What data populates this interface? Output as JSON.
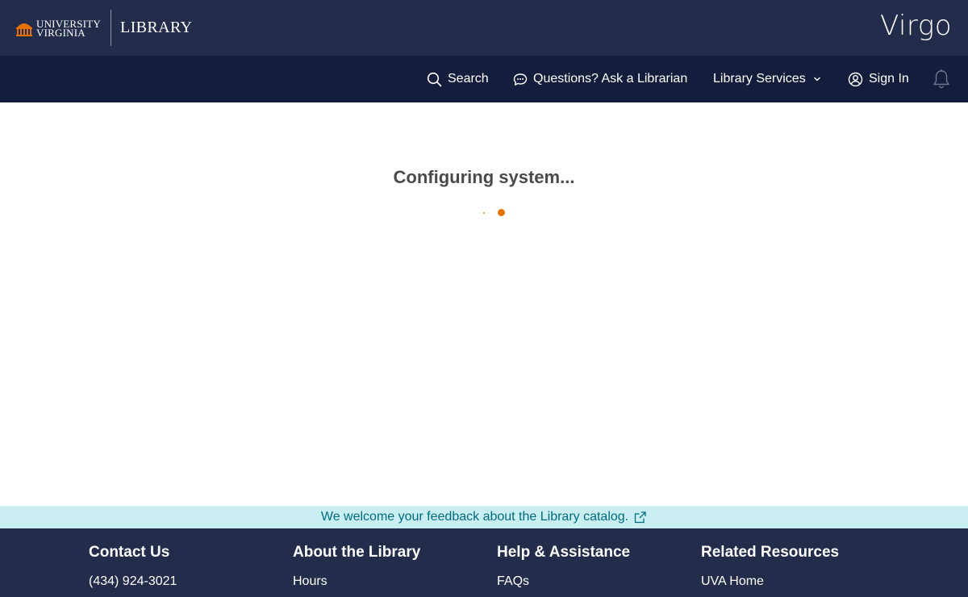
{
  "masthead": {
    "logo_line1": "UNIVERSITY",
    "logo_line2": "VIRGINIA",
    "logo_library": "LIBRARY",
    "app_name": "Virgo"
  },
  "nav": {
    "search": "Search",
    "ask": "Questions? Ask a Librarian",
    "services": "Library Services",
    "signin": "Sign In"
  },
  "main": {
    "status": "Configuring system..."
  },
  "feedback": {
    "text": "We welcome your feedback about the Library catalog."
  },
  "footer": {
    "columns": [
      {
        "title": "Contact Us",
        "first_link": "(434) 924-3021"
      },
      {
        "title": "About the Library",
        "first_link": "Hours"
      },
      {
        "title": "Help & Assistance",
        "first_link": "FAQs"
      },
      {
        "title": "Related Resources",
        "first_link": "UVA Home"
      }
    ]
  },
  "colors": {
    "masthead_bg": "#232d4b",
    "nav_bg": "#141e3c",
    "accent_orange": "#e57200",
    "feedback_bg": "#c9eff3",
    "feedback_text": "#006b7f"
  },
  "icons": [
    "rotunda-icon",
    "search-icon",
    "chat-icon",
    "chevron-down-icon",
    "user-circle-icon",
    "bell-icon",
    "external-link-icon"
  ]
}
